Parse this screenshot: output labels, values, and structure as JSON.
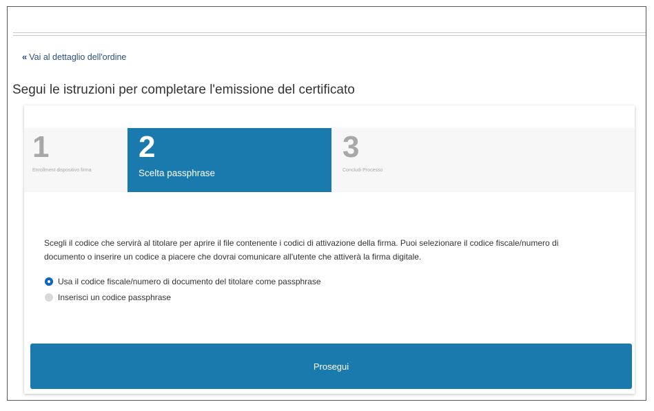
{
  "nav": {
    "back_icon": "double-chevron-left",
    "back_label": "Vai al dettaglio dell'ordine"
  },
  "page": {
    "title": "Segui le istruzioni per completare l'emissione del certificato"
  },
  "stepper": {
    "active_color": "#1a7aae",
    "steps": [
      {
        "number": "1",
        "label": "Enrollment dispositivo firma",
        "active": false
      },
      {
        "number": "2",
        "label": "Scelta passphrase",
        "active": true
      },
      {
        "number": "3",
        "label": "Concludi Processo",
        "active": false
      }
    ]
  },
  "content": {
    "description": "Scegli il codice che servirà al titolare per aprire il file contenente i codici di attivazione della firma. Puoi selezionare il codice fiscale/numero di documento o inserire un codice a piacere che dovrai comunicare all'utente che attiverà la firma digitale.",
    "options": [
      {
        "label": "Usa il codice fiscale/numero di documento del titolare come passphrase",
        "selected": true
      },
      {
        "label": "Inserisci un codice passphrase",
        "selected": false
      }
    ]
  },
  "actions": {
    "proceed_label": "Prosegui"
  }
}
